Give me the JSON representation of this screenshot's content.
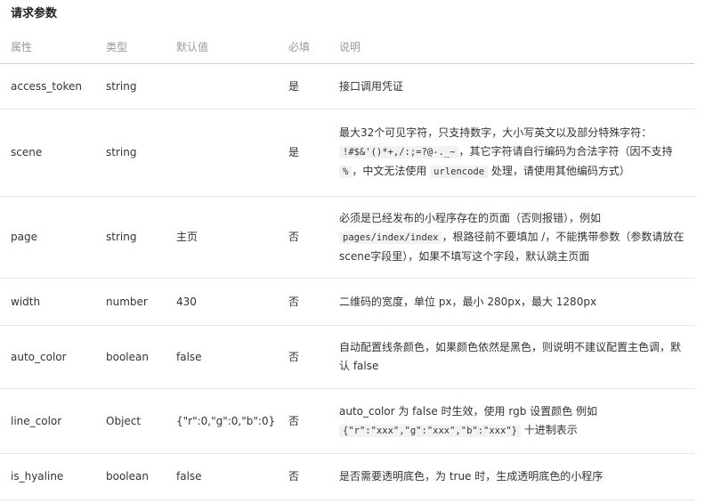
{
  "section_title": "请求参数",
  "columns": {
    "property": "属性",
    "type": "类型",
    "default": "默认值",
    "required": "必填",
    "description": "说明"
  },
  "rows": [
    {
      "name": "access_token",
      "type": "string",
      "default": "",
      "required": "是",
      "desc_text": "接口调用凭证"
    },
    {
      "name": "scene",
      "type": "string",
      "default": "",
      "required": "是",
      "desc_a": "最大32个可见字符，只支持数字，大小写英文以及部分特殊字符：",
      "code_a": "!#$&'()*+,/:;=?@-._~",
      "desc_b": "，其它字符请自行编码为合法字符（因不支持",
      "code_b": "%",
      "desc_c": "，中文无法使用",
      "code_c": "urlencode",
      "desc_d": "处理，请使用其他编码方式）"
    },
    {
      "name": "page",
      "type": "string",
      "default": "主页",
      "required": "否",
      "desc_a": "必须是已经发布的小程序存在的页面（否则报错），例如",
      "code_a": "pages/index/index",
      "desc_b": "，根路径前不要填加 /，不能携带参数（参数请放在scene字段里），如果不填写这个字段，默认跳主页面"
    },
    {
      "name": "width",
      "type": "number",
      "default": "430",
      "required": "否",
      "desc_text": "二维码的宽度，单位 px，最小 280px，最大 1280px"
    },
    {
      "name": "auto_color",
      "type": "boolean",
      "default": "false",
      "required": "否",
      "desc_text": "自动配置线条颜色，如果颜色依然是黑色，则说明不建议配置主色调，默认 false"
    },
    {
      "name": "line_color",
      "type": "Object",
      "default": "{\"r\":0,\"g\":0,\"b\":0}",
      "required": "否",
      "desc_a": "auto_color 为 false 时生效，使用 rgb 设置颜色 例如",
      "code_a": "{\"r\":\"xxx\",\"g\":\"xxx\",\"b\":\"xxx\"}",
      "desc_b": "十进制表示"
    },
    {
      "name": "is_hyaline",
      "type": "boolean",
      "default": "false",
      "required": "否",
      "desc_text": "是否需要透明底色，为 true 时，生成透明底色的小程序"
    }
  ]
}
